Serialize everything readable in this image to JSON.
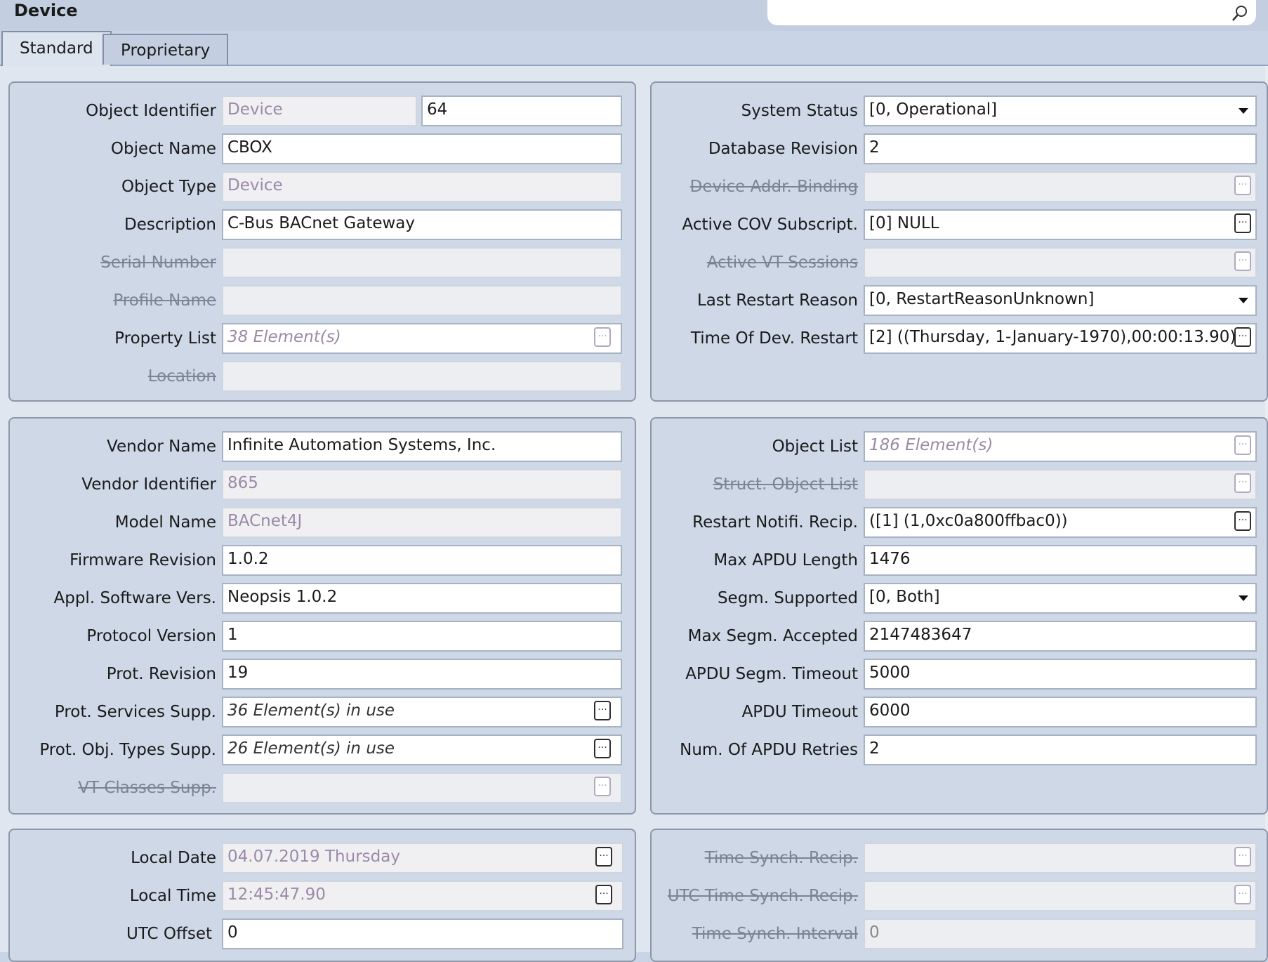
{
  "app": {
    "title": "Device"
  },
  "tabs": [
    {
      "label": "Standard"
    },
    {
      "label": "Proprietary"
    }
  ],
  "panel1": {
    "object_identifier": {
      "label": "Object Identifier",
      "type_value": "Device",
      "instance": "64"
    },
    "object_name": {
      "label": "Object Name",
      "value": "CBOX"
    },
    "object_type": {
      "label": "Object Type",
      "value": "Device"
    },
    "description": {
      "label": "Description",
      "value": "C-Bus BACnet Gateway"
    },
    "serial_number": {
      "label": "Serial Number",
      "value": ""
    },
    "profile_name": {
      "label": "Profile Name",
      "value": ""
    },
    "property_list": {
      "label": "Property List",
      "value": "38 Element(s)"
    },
    "location": {
      "label": "Location",
      "value": ""
    }
  },
  "panel2": {
    "system_status": {
      "label": "System Status",
      "value": "[0, Operational]"
    },
    "database_revision": {
      "label": "Database Revision",
      "value": "2"
    },
    "device_addr_binding": {
      "label": "Device Addr. Binding",
      "value": ""
    },
    "active_cov": {
      "label": "Active COV Subscript.",
      "value": "[0] NULL"
    },
    "active_vt": {
      "label": "Active VT Sessions",
      "value": ""
    },
    "last_restart_reason": {
      "label": "Last Restart Reason",
      "value": "[0, RestartReasonUnknown]"
    },
    "time_of_dev_restart": {
      "label": "Time Of Dev. Restart",
      "value": "[2] ((Thursday, 1-January-1970),00:00:13.90)"
    }
  },
  "panel3": {
    "vendor_name": {
      "label": "Vendor Name",
      "value": "Infinite Automation Systems, Inc."
    },
    "vendor_identifier": {
      "label": "Vendor Identifier",
      "value": "865"
    },
    "model_name": {
      "label": "Model Name",
      "value": "BACnet4J"
    },
    "firmware_revision": {
      "label": "Firmware Revision",
      "value": "1.0.2"
    },
    "appl_software": {
      "label": "Appl. Software Vers.",
      "value": "Neopsis 1.0.2"
    },
    "protocol_version": {
      "label": "Protocol Version",
      "value": "1"
    },
    "prot_revision": {
      "label": "Prot. Revision",
      "value": "19"
    },
    "prot_services": {
      "label": "Prot. Services Supp.",
      "value": "36 Element(s) in use"
    },
    "prot_obj_types": {
      "label": "Prot. Obj. Types Supp.",
      "value": "26 Element(s) in use"
    },
    "vt_classes": {
      "label": "VT Classes Supp.",
      "value": ""
    }
  },
  "panel4": {
    "object_list": {
      "label": "Object List",
      "value": "186 Element(s)"
    },
    "struct_object_list": {
      "label": "Struct. Object List",
      "value": ""
    },
    "restart_notifi": {
      "label": "Restart Notifi. Recip.",
      "value": "([1] (1,0xc0a800ffbac0))"
    },
    "max_apdu": {
      "label": "Max APDU Length",
      "value": "1476"
    },
    "segm_supported": {
      "label": "Segm. Supported",
      "value": "[0, Both]"
    },
    "max_segm": {
      "label": "Max Segm. Accepted",
      "value": "2147483647"
    },
    "apdu_segm_timeout": {
      "label": "APDU Segm. Timeout",
      "value": "5000"
    },
    "apdu_timeout": {
      "label": "APDU Timeout",
      "value": "6000"
    },
    "num_apdu_retries": {
      "label": "Num. Of APDU Retries",
      "value": "2"
    }
  },
  "panel5": {
    "local_date": {
      "label": "Local Date",
      "value": "04.07.2019 Thursday"
    },
    "local_time": {
      "label": "Local Time",
      "value": "12:45:47.90"
    },
    "utc_offset": {
      "label": "UTC Offset",
      "value": "0"
    }
  },
  "panel6": {
    "time_synch_recip": {
      "label": "Time Synch. Recip.",
      "value": ""
    },
    "utc_time_synch": {
      "label": "UTC Time Synch. Recip.",
      "value": ""
    },
    "time_synch_interval": {
      "label": "Time Synch. Interval",
      "value": "0"
    }
  }
}
